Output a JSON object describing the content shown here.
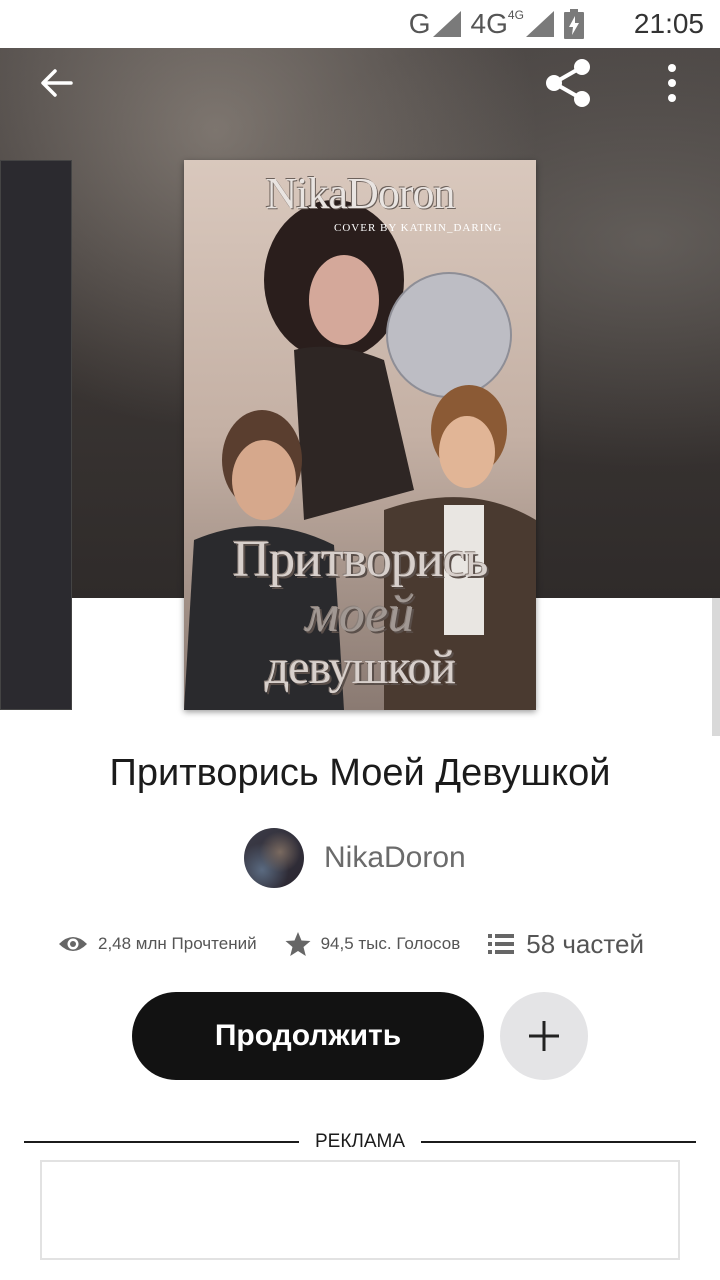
{
  "status_bar": {
    "network_1": "G",
    "network_2": "4G",
    "network_2_small": "4G",
    "time": "21:05"
  },
  "toolbar": {
    "back_icon": "arrow-left-icon",
    "share_icon": "share-icon",
    "more_icon": "more-vertical-icon"
  },
  "cover": {
    "brand": "NikaDoron",
    "credit": "COVER BY KATRIN_DARING",
    "title_line_1": "Притворись",
    "title_line_2": "моей",
    "title_line_3": "девушкой"
  },
  "book": {
    "title": "Притворись Моей Девушкой",
    "author": "NikaDoron"
  },
  "stats": {
    "reads_icon": "eye-icon",
    "reads": "2,48 млн Прочтений",
    "votes_icon": "star-icon",
    "votes": "94,5 тыс. Голосов",
    "parts_icon": "list-icon",
    "parts": "58 частей"
  },
  "actions": {
    "continue_label": "Продолжить",
    "add_icon": "plus-icon"
  },
  "ad": {
    "label": "РЕКЛАМА"
  },
  "colors": {
    "button_dark": "#121212",
    "add_button_bg": "#e4e4e6",
    "hero_bg": "#3a3533"
  }
}
